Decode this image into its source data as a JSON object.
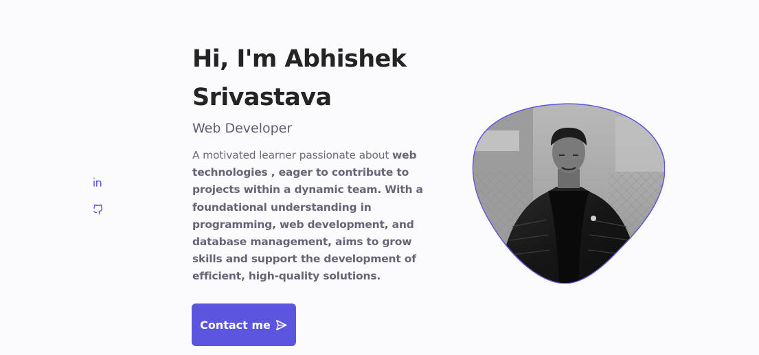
{
  "social": {
    "linkedin_icon": "linkedin-icon",
    "github_icon": "github-icon"
  },
  "hero": {
    "title_line1": "Hi, I'm Abhishek",
    "title_line2": "Srivastava",
    "subtitle": "Web Developer",
    "description_intro": "A motivated learner passionate about ",
    "description_bold": "web technologies , eager to contribute to projects within a dynamic team. With a foundational understanding in programming, web development, and database management, aims to grow skills and support the development of efficient, high-quality solutions.",
    "contact_label": "Contact me",
    "contact_icon": "send-icon",
    "photo": "profile-photo"
  },
  "colors": {
    "accent": "#5b55e0",
    "background": "#fbfbfd",
    "title": "#242424",
    "text": "#6b6b7c"
  }
}
